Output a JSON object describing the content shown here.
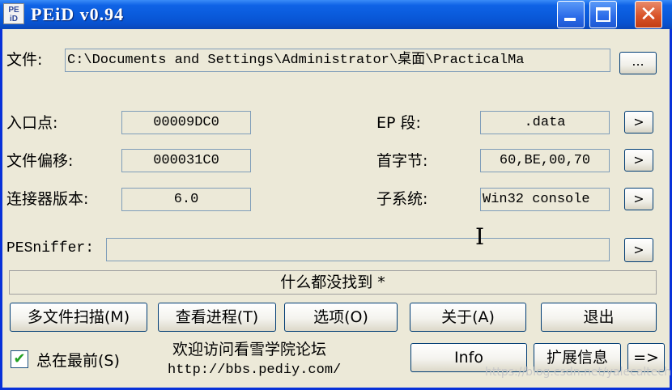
{
  "window": {
    "icon_text": "PE\niD",
    "title": "PEiD v0.94"
  },
  "file": {
    "label": "文件:",
    "path": "C:\\Documents and Settings\\Administrator\\桌面\\PracticalMa",
    "browse_label": "..."
  },
  "fields": {
    "entry_point": {
      "label": "入口点:",
      "value": "00009DC0"
    },
    "file_offset": {
      "label": "文件偏移:",
      "value": "000031C0"
    },
    "linker_version": {
      "label": "连接器版本:",
      "value": "6.0"
    },
    "ep_section": {
      "label": "EP 段:",
      "value": ".data"
    },
    "first_bytes": {
      "label": "首字节:",
      "value": "60,BE,00,70"
    },
    "subsystem": {
      "label": "子系统:",
      "value": "Win32 console"
    }
  },
  "arrow_label": ">",
  "pesniffer": {
    "label": "PESniffer:",
    "value": ""
  },
  "status": {
    "text": "什么都没找到  *"
  },
  "buttons": {
    "multi_scan": "多文件扫描(M)",
    "view_process": "查看进程(T)",
    "options": "选项(O)",
    "about": "关于(A)",
    "exit": "退出",
    "info": "Info",
    "extra_info": "扩展信息",
    "more": "=>"
  },
  "always_on_top": {
    "label": "总在最前(S)",
    "checked": true
  },
  "forum": {
    "line1": "欢迎访问看雪学院论坛",
    "line2": "http://bbs.pediy.com/"
  },
  "watermark": "https://blog.csdn.net/yalecaltech"
}
